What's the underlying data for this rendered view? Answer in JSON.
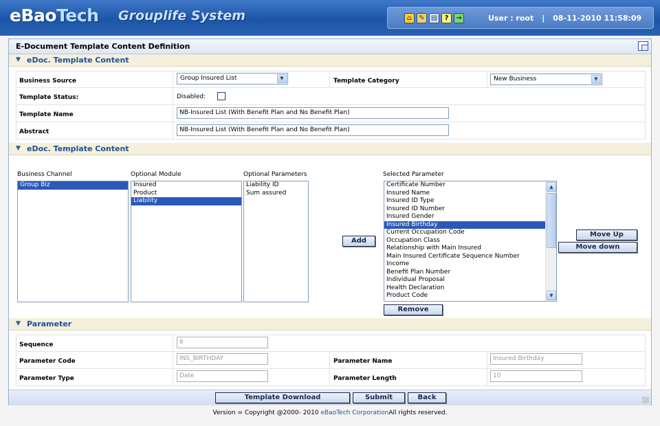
{
  "app": {
    "logo_prefix": "eBao",
    "logo_suffix": "Tech",
    "system_title": "Grouplife System"
  },
  "user": {
    "label": "User : root",
    "datetime": "08-11-2010 11:58:09"
  },
  "page": {
    "title": "E-Document Template Content Definition"
  },
  "section1": {
    "title": "eDoc. Template Content",
    "business_source_label": "Business Source",
    "business_source_value": "Group Insured List",
    "template_category_label": "Template Category",
    "template_category_value": "New Business",
    "template_status_label": "Template Status:",
    "disabled_label": "Disabled:",
    "template_name_label": "Template Name",
    "template_name_value": "NB-Insured List (With Benefit Plan and No Benefit Plan)",
    "abstract_label": "Abstract",
    "abstract_value": "NB-Insured List (With Benefit Plan and No Benefit Plan)"
  },
  "section2": {
    "title": "eDoc. Template Content",
    "business_channel_label": "Business Channel",
    "business_channel_items": [
      "Group Biz"
    ],
    "optional_module_label": "Optional Module",
    "optional_module_items": [
      "Insured",
      "Product",
      "Liability"
    ],
    "optional_params_label": "Optional Parameters",
    "optional_params_items": [
      "Liability ID",
      "Sum assured"
    ],
    "selected_param_label": "Selected Parameter",
    "selected_param_items": [
      "Certificate Number",
      "Insured Name",
      "Insured ID Type",
      "Insured ID Number",
      "Insured Gender",
      "Insured Birthday",
      "Current Occupation Code",
      "Occupation Class",
      "Relationship with Main Insured",
      "Main Insured Certificate Sequence Number",
      "Income",
      "Benefit Plan Number",
      "Individual Proposal",
      "Health Declaration",
      "Product Code"
    ],
    "add_label": "Add",
    "remove_label": "Remove",
    "move_up_label": "Move Up",
    "move_down_label": "Move down"
  },
  "section3": {
    "title": "Parameter",
    "sequence_label": "Sequence",
    "sequence_value": "6",
    "param_code_label": "Parameter Code",
    "param_code_value": "INS_BIRTHDAY",
    "param_name_label": "Parameter Name",
    "param_name_value": "Insured Birthday",
    "param_type_label": "Parameter Type",
    "param_type_value": "Date",
    "param_length_label": "Parameter Length",
    "param_length_value": "10"
  },
  "actions": {
    "download_label": "Template Download",
    "submit_label": "Submit",
    "back_label": "Back"
  },
  "footer": {
    "prefix": "Version =   Copyright @2000- 2010 ",
    "company": "eBaoTech Corporation",
    "suffix": "All rights reserved."
  },
  "icons": [
    "home-icon",
    "notes-icon",
    "monitor-icon",
    "help-icon",
    "exit-icon"
  ]
}
